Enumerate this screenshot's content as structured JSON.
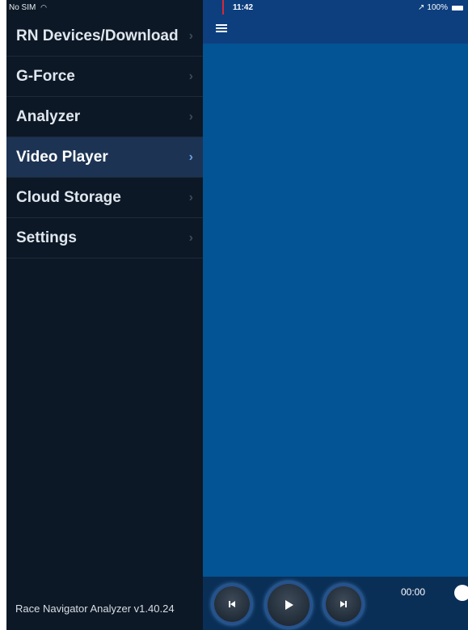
{
  "status": {
    "carrier": "No SIM",
    "time": "11:42",
    "battery": "100%"
  },
  "menu": {
    "items": [
      {
        "label": "RN Devices/Download"
      },
      {
        "label": "G-Force"
      },
      {
        "label": "Analyzer"
      },
      {
        "label": "Video Player",
        "active": true
      },
      {
        "label": "Cloud Storage"
      },
      {
        "label": "Settings"
      }
    ]
  },
  "footer": {
    "version": "Race Navigator Analyzer v1.40.24"
  },
  "player": {
    "time": "00:00",
    "buttons": [
      "skip-back-icon",
      "play-icon",
      "skip-forward-icon"
    ]
  },
  "colors": {
    "sidebar_bg": "#0c1826",
    "active_item_bg": "#1c3354",
    "main_bg": "#025495",
    "topbar_bg": "#0d3f7e"
  }
}
